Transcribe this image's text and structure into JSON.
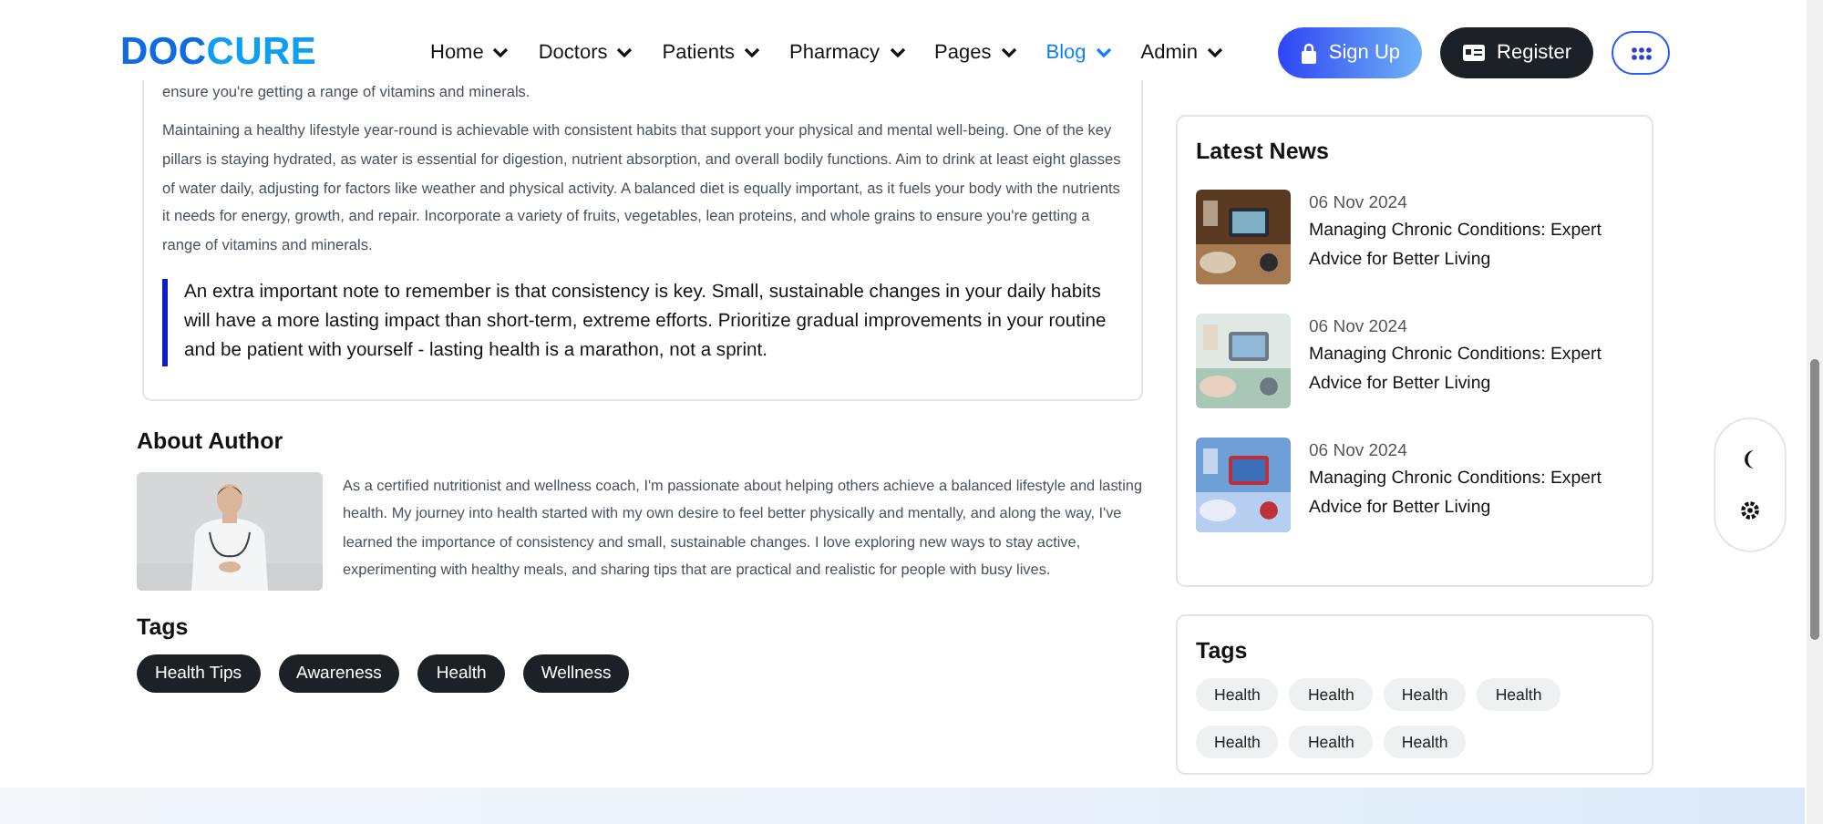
{
  "header": {
    "logo": [
      "DOC",
      "CURE"
    ],
    "nav": [
      {
        "label": "Home",
        "selected": false
      },
      {
        "label": "Doctors",
        "selected": false
      },
      {
        "label": "Patients",
        "selected": false
      },
      {
        "label": "Pharmacy",
        "selected": false
      },
      {
        "label": "Pages",
        "selected": false
      },
      {
        "label": "Blog",
        "selected": true
      },
      {
        "label": "Admin",
        "selected": false
      }
    ],
    "buttons": [
      {
        "kind": "signup",
        "label": "Sign Up"
      },
      {
        "kind": "register",
        "label": "Register"
      },
      {
        "kind": "apps"
      }
    ]
  },
  "article": {
    "cut_line": "ensure you're getting a range of vitamins and minerals.",
    "paragraph": "Maintaining a healthy lifestyle year-round is achievable with consistent habits that support your physical and mental well-being. One of the key pillars is staying hydrated, as water is essential for digestion, nutrient absorption, and overall bodily functions. Aim to drink at least eight glasses of water daily, adjusting for factors like weather and physical activity. A balanced diet is equally important, as it fuels your body with the nutrients it needs for energy, growth, and repair. Incorporate a variety of fruits, vegetables, lean proteins, and whole grains to ensure you're getting a range of vitamins and minerals.",
    "quote": "An extra important note to remember is that consistency is key. Small, sustainable changes in your daily habits will have a more lasting impact than short-term, extreme efforts. Prioritize gradual improvements in your routine and be patient with yourself - lasting health is a marathon, not a sprint."
  },
  "author": {
    "title": "About Author",
    "bio": "As a certified nutritionist and wellness coach, I'm passionate about helping others achieve a balanced lifestyle and lasting health. My journey into health started with my own desire to feel better physically and mentally, and along the way, I've learned the importance of consistency and small, sustainable changes. I love exploring new ways to stay active, experimenting with healthy meals, and sharing tips that are practical and realistic for people with busy lives."
  },
  "tags": {
    "title": "Tags",
    "items": [
      "Health Tips",
      "Awareness",
      "Health",
      "Wellness"
    ]
  },
  "latest_news": {
    "title": "Latest News",
    "items": [
      {
        "date": "06 Nov 2024",
        "title": "Managing Chronic Conditions: Expert Advice for Better Living",
        "kind": "picture"
      },
      {
        "date": "06 Nov 2024",
        "title": "Managing Chronic Conditions: Expert Advice for Better Living",
        "kind": "picture"
      },
      {
        "date": "06 Nov 2024",
        "title": "Managing Chronic Conditions: Expert Advice for Better Living",
        "kind": "picture"
      }
    ]
  },
  "sidebar_tags": {
    "title": "Tags",
    "items": [
      "Health",
      "Health",
      "Health",
      "Health",
      "Health",
      "Health",
      "Health"
    ]
  }
}
